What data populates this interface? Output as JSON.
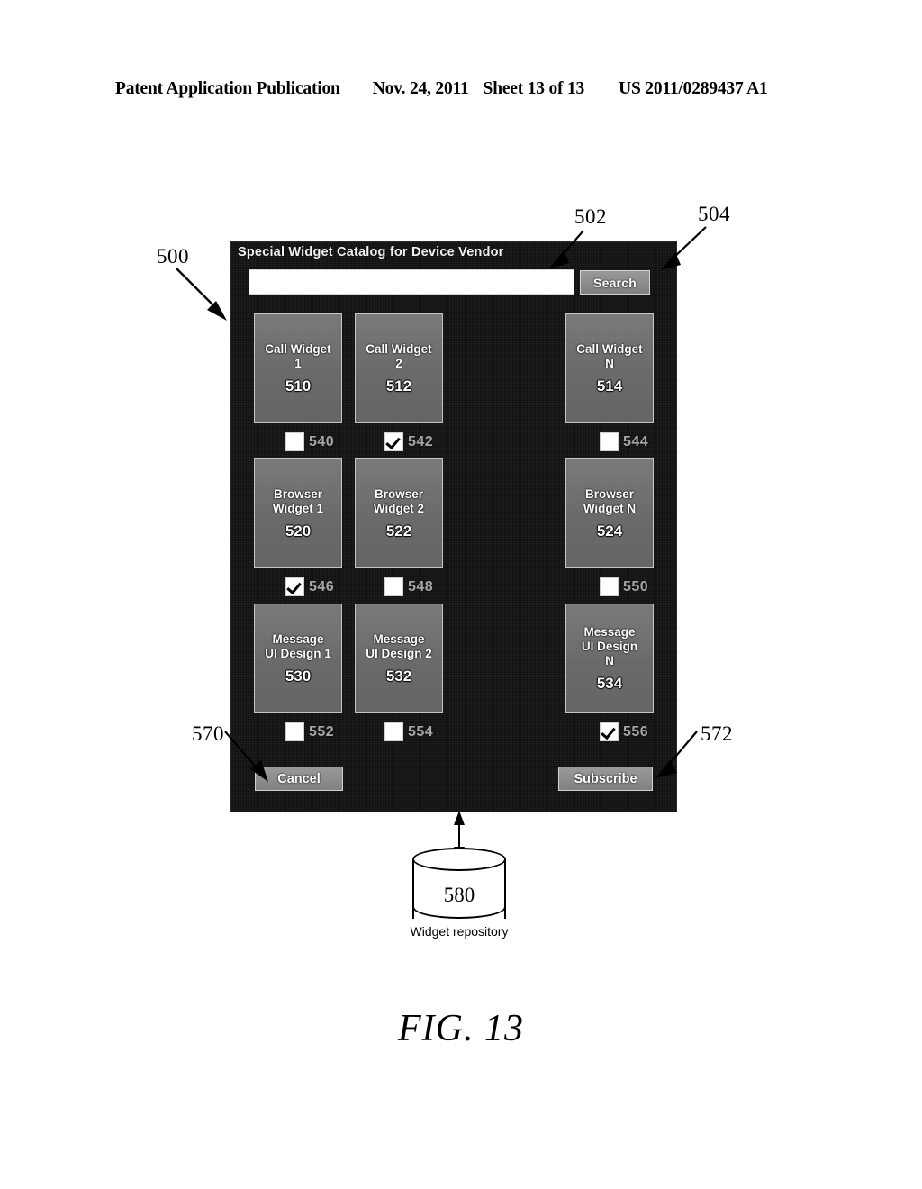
{
  "page_header": {
    "publication": "Patent Application Publication",
    "date": "Nov. 24, 2011",
    "sheet": "Sheet 13 of 13",
    "patent_number": "US 2011/0289437 A1"
  },
  "figure": {
    "caption": "FIG. 13"
  },
  "dialog": {
    "title": "Special Widget Catalog for Device Vendor",
    "ref": "500",
    "search": {
      "value": "",
      "placeholder": "",
      "input_ref": "502",
      "button_label": "Search",
      "button_ref": "504"
    },
    "rows": [
      {
        "tiles": [
          {
            "label": "Call Widget\n1",
            "ref": "510"
          },
          {
            "label": "Call Widget\n2",
            "ref": "512"
          },
          {
            "label": "Call Widget\nN",
            "ref": "514"
          }
        ],
        "checkboxes": [
          {
            "ref": "540",
            "checked": false
          },
          {
            "ref": "542",
            "checked": true
          },
          {
            "ref": "544",
            "checked": false
          }
        ]
      },
      {
        "tiles": [
          {
            "label": "Browser\nWidget 1",
            "ref": "520"
          },
          {
            "label": "Browser\nWidget 2",
            "ref": "522"
          },
          {
            "label": "Browser\nWidget N",
            "ref": "524"
          }
        ],
        "checkboxes": [
          {
            "ref": "546",
            "checked": true
          },
          {
            "ref": "548",
            "checked": false
          },
          {
            "ref": "550",
            "checked": false
          }
        ]
      },
      {
        "tiles": [
          {
            "label": "Message\nUI Design 1",
            "ref": "530"
          },
          {
            "label": "Message\nUI Design 2",
            "ref": "532"
          },
          {
            "label": "Message\nUI Design\nN",
            "ref": "534"
          }
        ],
        "checkboxes": [
          {
            "ref": "552",
            "checked": false
          },
          {
            "ref": "554",
            "checked": false
          },
          {
            "ref": "556",
            "checked": true
          }
        ]
      }
    ],
    "footer": {
      "cancel_label": "Cancel",
      "cancel_ref": "570",
      "subscribe_label": "Subscribe",
      "subscribe_ref": "572"
    }
  },
  "repository": {
    "ref": "580",
    "caption": "Widget repository"
  }
}
